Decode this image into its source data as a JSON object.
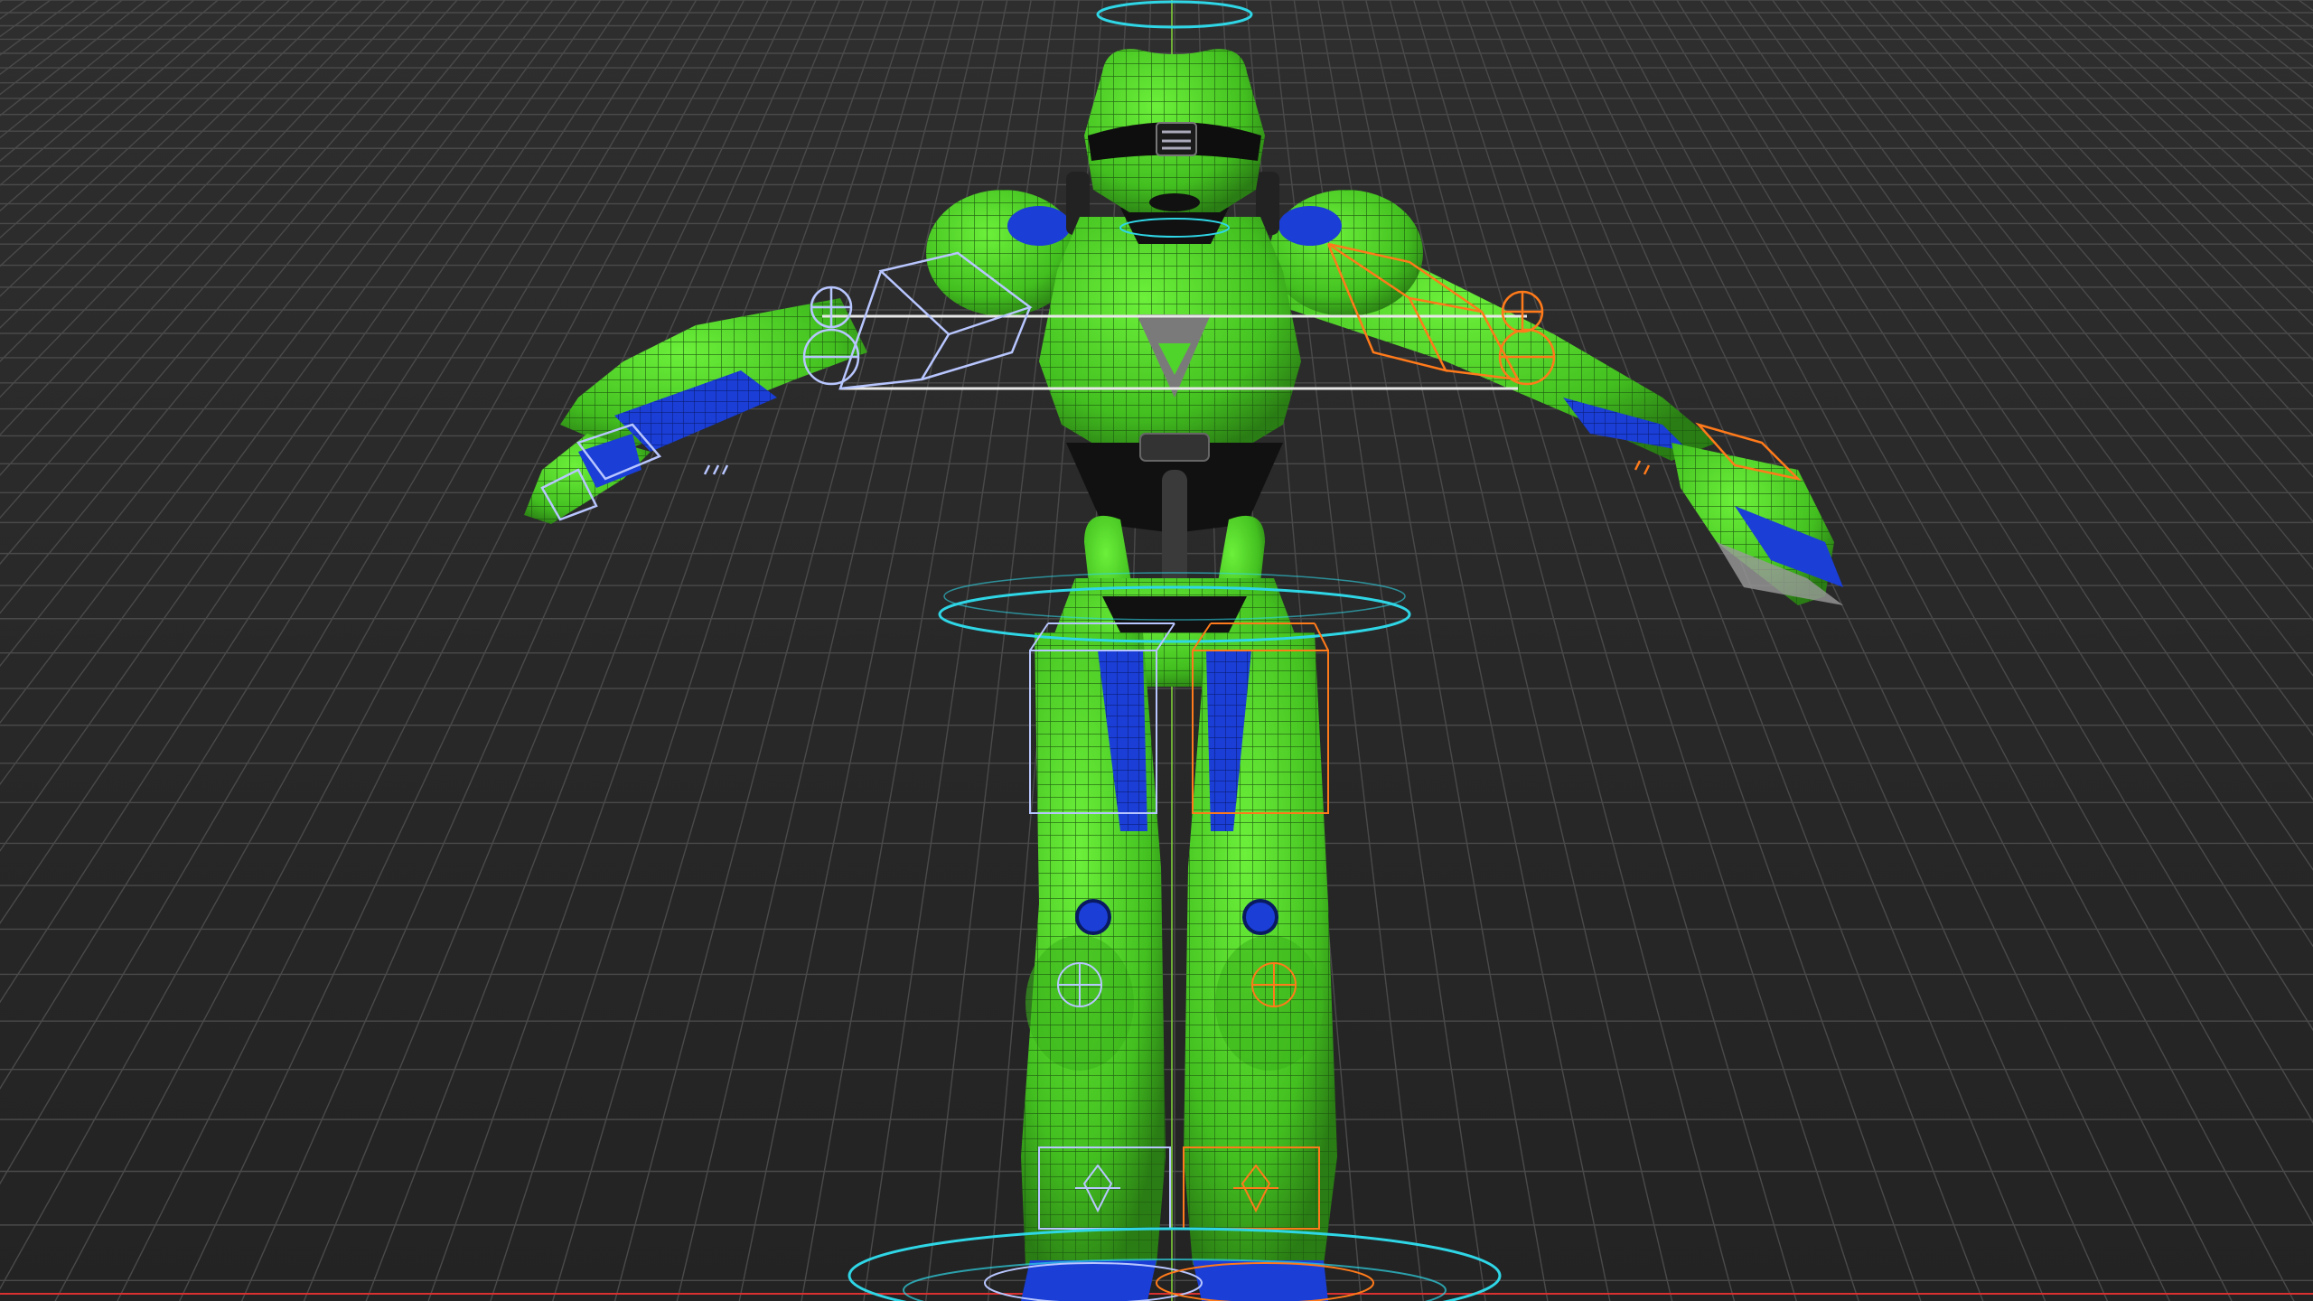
{
  "viewport": {
    "background_color": "#2b2b2b",
    "grid_color": "#4a4a4a",
    "mesh_color": "#4fd42b",
    "mesh_dark_color": "#1f6a12",
    "accent_color": "#1a3ed6",
    "rig_colors": {
      "left_side": "#b8c6ff",
      "right_side": "#ff7a1a",
      "center": "#2fd6e6",
      "axis_x": "#d93030",
      "axis_y": "#7fcf3a"
    }
  },
  "model": {
    "subject": "green-robot-character",
    "pose": "t-pose",
    "display": "shaded-wireframe"
  }
}
